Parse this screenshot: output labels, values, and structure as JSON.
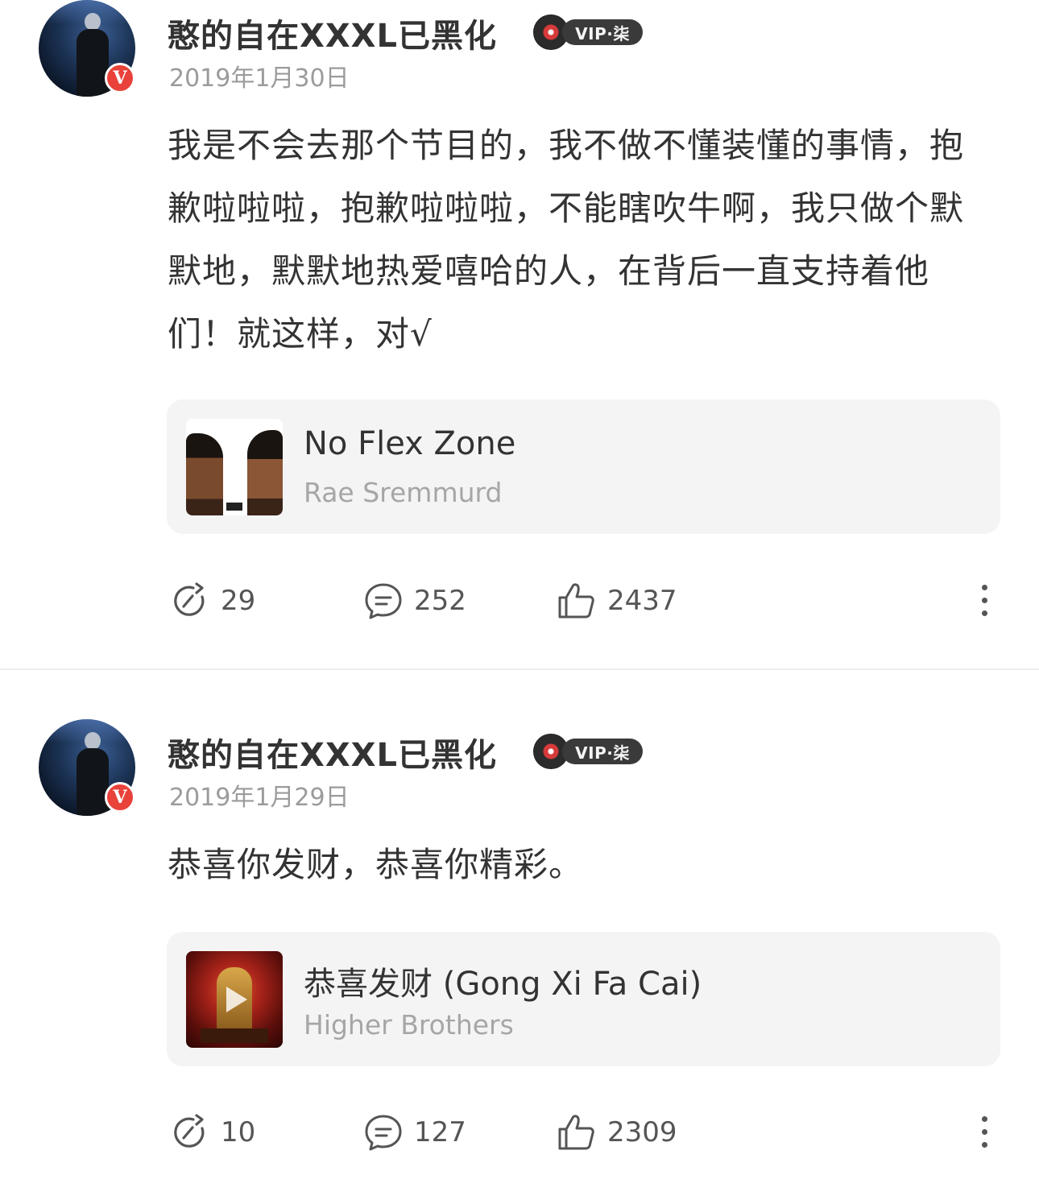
{
  "posts": [
    {
      "author": "憨的自在XXXL已黑化",
      "vip_label": "VIP·柒",
      "date": "2019年1月30日",
      "text": "我是不会去那个节目的，我不做不懂装懂的事情，抱歉啦啦啦，抱歉啦啦啦，不能瞎吹牛啊，我只做个默默地，默默地热爱嘻哈的人，在背后一直支持着他们！就这样，对√",
      "song": {
        "title": "No Flex Zone",
        "artist": "Rae Sremmurd"
      },
      "stats": {
        "reposts": "29",
        "comments": "252",
        "likes": "2437"
      }
    },
    {
      "author": "憨的自在XXXL已黑化",
      "vip_label": "VIP·柒",
      "date": "2019年1月29日",
      "text": "恭喜你发财，恭喜你精彩。",
      "song": {
        "title": "恭喜发财 (Gong Xi Fa Cai)",
        "artist": "Higher Brothers"
      },
      "stats": {
        "reposts": "10",
        "comments": "127",
        "likes": "2309"
      }
    }
  ],
  "verified_badge": "V",
  "colors": {
    "verified_red": "#e8423a",
    "text_primary": "#333333",
    "text_secondary": "#9b9b9b",
    "card_bg": "#f4f4f4"
  },
  "icons": {
    "repost": "repost-icon",
    "comment": "comment-icon",
    "like": "thumbs-up-icon",
    "more": "more-vertical-icon"
  }
}
